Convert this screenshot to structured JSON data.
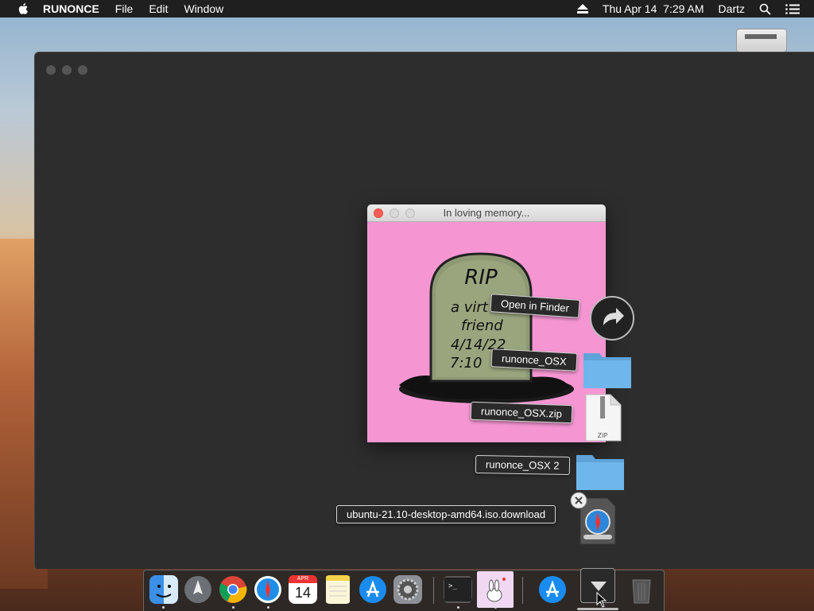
{
  "menubar": {
    "app_name": "RUNONCE",
    "items": [
      "File",
      "Edit",
      "Window"
    ],
    "date": "Thu Apr 14",
    "time": "7:29 AM",
    "user": "Dartz"
  },
  "memorial_window": {
    "title": "In loving memory...",
    "tombstone": {
      "heading": "RIP",
      "line1": "a virt",
      "line2": "friend",
      "line3": "4/14/22",
      "line4": "7:10"
    },
    "background_color": "#f596d3"
  },
  "stack": {
    "open_label": "Open in Finder",
    "items": [
      {
        "label": "runonce_OSX",
        "icon": "folder-icon"
      },
      {
        "label": "runonce_OSX.zip",
        "icon": "zip-file-icon",
        "badge": "ZIP"
      },
      {
        "label": "runonce_OSX 2",
        "icon": "folder-icon"
      },
      {
        "label": "ubuntu-21.10-desktop-amd64.iso.download",
        "icon": "safari-download-icon"
      }
    ]
  },
  "dock": {
    "calendar_month": "APR",
    "calendar_day": "14",
    "apps": [
      "finder",
      "launchpad",
      "chrome",
      "safari",
      "calendar",
      "notes",
      "app-store",
      "system-preferences",
      "terminal",
      "runonce",
      "app-store-2",
      "downloads",
      "trash"
    ]
  }
}
